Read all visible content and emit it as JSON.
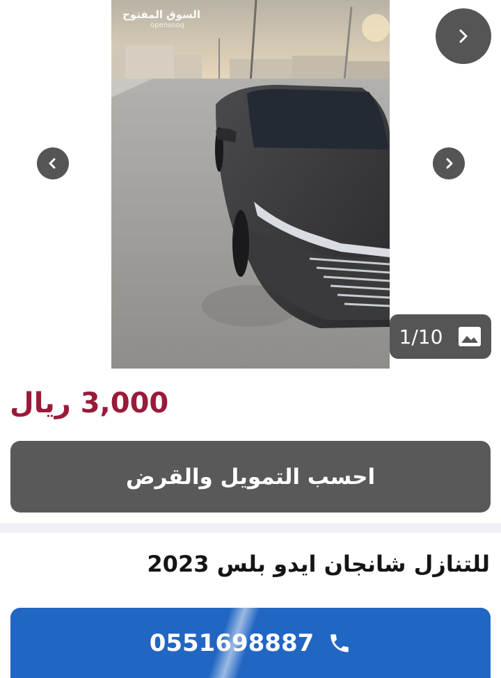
{
  "gallery": {
    "watermark_ar": "السوق المفتوح",
    "watermark_en": "opensooq",
    "counter": "1/10"
  },
  "listing": {
    "price": "3,000 ريال",
    "finance_button_label": "احسب التمويل والقرض",
    "title": "للتنازل شانجان ايدو بلس 2023",
    "phone": "0551698887"
  },
  "colors": {
    "price": "#9a1a3a",
    "finance_button": "#595959",
    "call_button": "#2266c3"
  },
  "icons": {
    "next": "chevron-right-icon",
    "prev": "chevron-left-icon",
    "gallery": "image-icon",
    "call": "phone-icon"
  }
}
